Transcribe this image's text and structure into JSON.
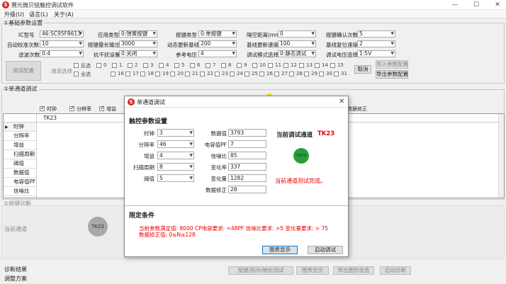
{
  "window": {
    "title": "赛元微贝锐触控调试软件",
    "app_icon": "S"
  },
  "menu": [
    "升级(U)",
    "语言(L)",
    "关于(A)"
  ],
  "basic": {
    "title": "①基础参数设置",
    "rows": [
      [
        {
          "label": "IC型号",
          "value": "46:SC95F8613"
        },
        {
          "label": "应用类型",
          "value": "0:弹簧按键"
        },
        {
          "label": "按键类型",
          "value": "0:单按键"
        },
        {
          "label": "隔空距离(mm)",
          "value": "0"
        },
        {
          "label": "按键确认次数",
          "value": "5"
        }
      ],
      [
        {
          "label": "自动校准次数",
          "value": "10"
        },
        {
          "label": "按键最长输出",
          "value": "3000"
        },
        {
          "label": "动态更新基线",
          "value": "200"
        },
        {
          "label": "基线更新速度",
          "value": "100"
        },
        {
          "label": "基线复位速度",
          "value": "2"
        }
      ],
      [
        {
          "label": "滤波次数",
          "value": "0:4"
        },
        {
          "label": "抗干扰设置",
          "value": "0:关闭"
        },
        {
          "label": "参考电压",
          "value": "4"
        },
        {
          "label": "调试模式选择",
          "value": "0:静态调试"
        },
        {
          "label": "调试电压选择",
          "value": "1:5V"
        }
      ]
    ],
    "select_btn": "通道配置",
    "select_label": "通道选择",
    "reverse": "反选",
    "all": "全选",
    "channels_row1": [
      "0",
      "1",
      "2",
      "3",
      "4",
      "5",
      "6",
      "7",
      "8",
      "9",
      "10",
      "11",
      "12",
      "13",
      "14",
      "15"
    ],
    "channels_row2": [
      "16",
      "17",
      "18",
      "19",
      "20",
      "21",
      "22",
      "23",
      "24",
      "25",
      "26",
      "27",
      "28",
      "29",
      "30",
      "31"
    ],
    "cancel_btn": "取消",
    "import_btn": "导入参数配置",
    "export_btn": "导出参数配置"
  },
  "single": {
    "title": "②单通道调试",
    "checks": [
      "时钟",
      "分辨率",
      "增益"
    ],
    "right_label": "数据修正",
    "grid_header": "TK23",
    "grid_rows": [
      "时钟",
      "分辨率",
      "增益",
      "扫描周期",
      "阈值",
      "数据值",
      "电容值PF",
      "信噪比"
    ]
  },
  "section3": {
    "title": "③按键诊断",
    "channel_label": "当前通道",
    "chip": "TK23"
  },
  "footer": {
    "labels": [
      "诊断结果",
      "调整方案"
    ],
    "buttons": [
      "按键/指示/被松测试",
      "图表显示",
      "导出图形信息",
      "启动诊断"
    ]
  },
  "dialog": {
    "title": "单通道调试",
    "section_title": "触控参数设置",
    "left_fields": [
      {
        "label": "时钟",
        "value": "3"
      },
      {
        "label": "分辨率",
        "value": "46"
      },
      {
        "label": "增益",
        "value": "4"
      },
      {
        "label": "扫描周期",
        "value": "8"
      },
      {
        "label": "阈值",
        "value": "5"
      }
    ],
    "right_fields": [
      {
        "label": "数据值",
        "value": "3793"
      },
      {
        "label": "电容值PF",
        "value": "7"
      },
      {
        "label": "信噪比",
        "value": "85"
      },
      {
        "label": "变化率",
        "value": "337"
      },
      {
        "label": "变化量",
        "value": "1282"
      },
      {
        "label": "数据修正",
        "value": "28"
      }
    ],
    "current_label": "当前调试通道",
    "current_value": "TK23",
    "status_led": "TK23",
    "status_msg": "当前通道测试完成。",
    "limit_title": "限定条件",
    "limit_line1": "当前参数满足值: 8000  CP电容要求: <48PF  信噪比要求: >5  变化量要求: > 75",
    "limit_line2": "数据修正值: 0≤N≤128",
    "chart_btn": "图表显示",
    "start_btn": "启动调试",
    "close": "✕"
  },
  "colors": {
    "accent": "#e00000",
    "led": "#2a9d3a"
  }
}
